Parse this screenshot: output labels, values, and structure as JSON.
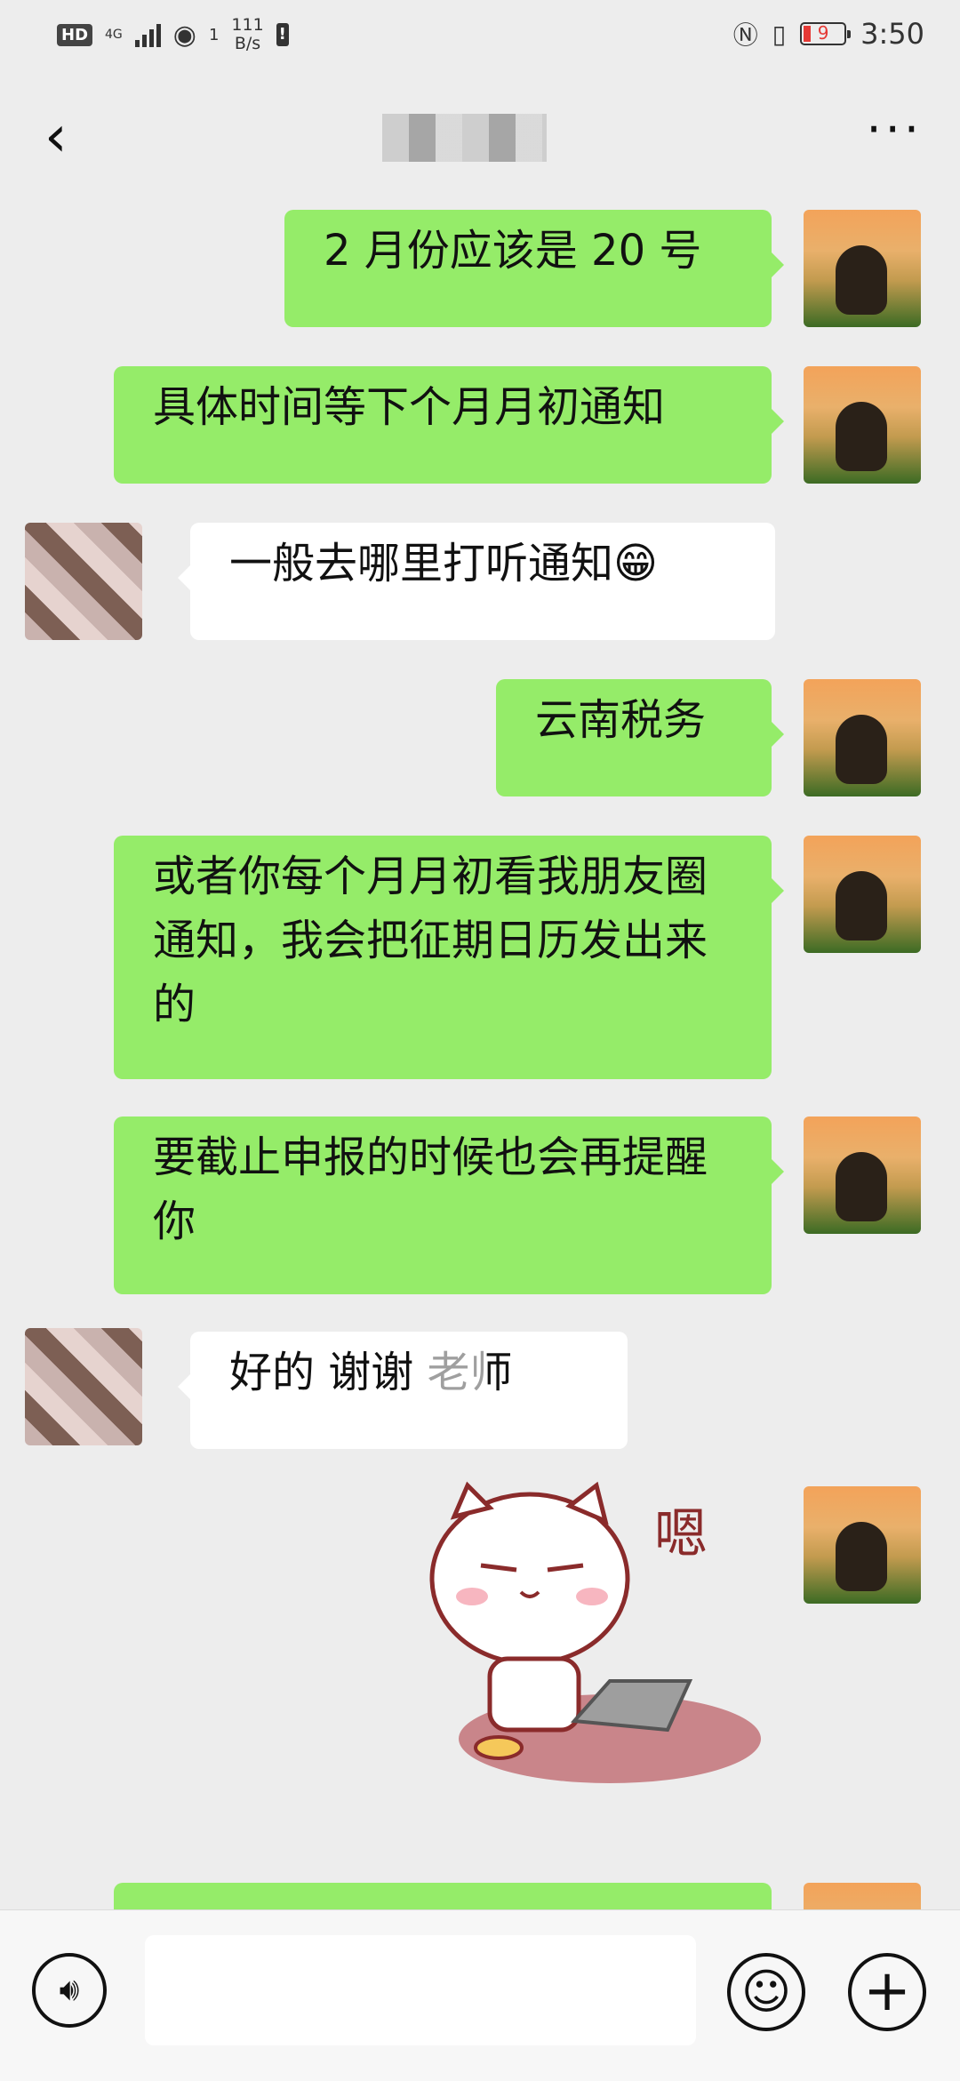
{
  "status_bar": {
    "hd": "HD",
    "network": "4G",
    "wifi_index": "1",
    "speed_value": "111",
    "speed_unit": "B/s",
    "battery": "9",
    "time": "3:50"
  },
  "header": {
    "back_icon": "chevron-left-icon",
    "more_icon": "more-dots-icon"
  },
  "messages": [
    {
      "side": "me",
      "text": "2 月份应该是 20 号"
    },
    {
      "side": "me",
      "text": "具体时间等下个月月初通知"
    },
    {
      "side": "other",
      "text": "一般去哪里打听通知😁"
    },
    {
      "side": "me",
      "text": "云南税务"
    },
    {
      "side": "me",
      "text": "或者你每个月月初看我朋友圈通知，我会把征期日历发出来的"
    },
    {
      "side": "me",
      "text": "要截止申报的时候也会再提醒你"
    },
    {
      "side": "other",
      "text": "好的 谢谢  老师"
    },
    {
      "side": "me",
      "type": "sticker",
      "sticker_text": "嗯"
    }
  ],
  "input_bar": {
    "voice_icon": "voice-icon",
    "emoji_icon": "emoji-icon",
    "plus_icon": "plus-icon",
    "input_value": ""
  },
  "colors": {
    "sent_bubble": "#95ec69",
    "received_bubble": "#ffffff",
    "background": "#ededed"
  }
}
